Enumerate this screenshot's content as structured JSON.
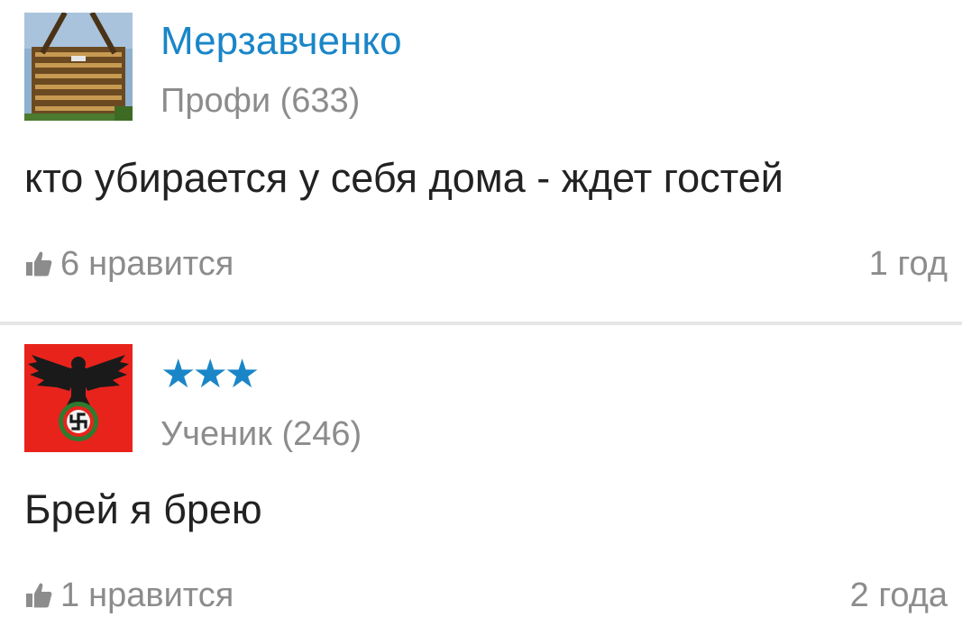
{
  "answers": [
    {
      "username": "Мерзавченко",
      "rank": "Профи (633)",
      "text": "кто убирается у себя дома - ждет гостей",
      "like_count": "6",
      "like_label": "нравится",
      "time": "1 год",
      "avatar_icon": "building-avatar-icon"
    },
    {
      "username_stars": "★★★",
      "rank": "Ученик (246)",
      "text": "Брей я брею",
      "like_count": "1",
      "like_label": "нравится",
      "time": "2 года",
      "avatar_icon": "eagle-emblem-avatar-icon"
    }
  ],
  "colors": {
    "link": "#1a86c8",
    "muted": "#8c8c8c",
    "text": "#222222",
    "divider": "#e6e6e6"
  },
  "icons": {
    "like": "thumbs-up-icon"
  }
}
